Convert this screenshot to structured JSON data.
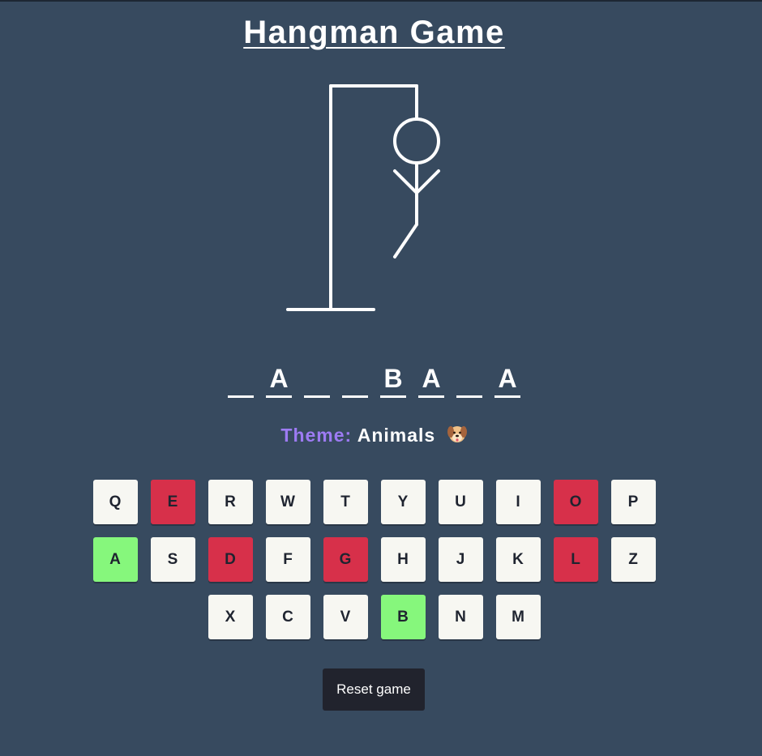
{
  "title": "Hangman Game",
  "word_slots": [
    "",
    "A",
    "",
    "",
    "B",
    "A",
    "",
    "A"
  ],
  "theme": {
    "label": "Theme:",
    "value": "Animals",
    "icon": "dog-face-icon"
  },
  "keyboard": {
    "rows": [
      [
        {
          "letter": "Q",
          "state": "unused"
        },
        {
          "letter": "E",
          "state": "wrong"
        },
        {
          "letter": "R",
          "state": "unused"
        },
        {
          "letter": "W",
          "state": "unused"
        },
        {
          "letter": "T",
          "state": "unused"
        },
        {
          "letter": "Y",
          "state": "unused"
        },
        {
          "letter": "U",
          "state": "unused"
        },
        {
          "letter": "I",
          "state": "unused"
        },
        {
          "letter": "O",
          "state": "wrong"
        },
        {
          "letter": "P",
          "state": "unused"
        }
      ],
      [
        {
          "letter": "A",
          "state": "correct"
        },
        {
          "letter": "S",
          "state": "unused"
        },
        {
          "letter": "D",
          "state": "wrong"
        },
        {
          "letter": "F",
          "state": "unused"
        },
        {
          "letter": "G",
          "state": "wrong"
        },
        {
          "letter": "H",
          "state": "unused"
        },
        {
          "letter": "J",
          "state": "unused"
        },
        {
          "letter": "K",
          "state": "unused"
        },
        {
          "letter": "L",
          "state": "wrong"
        },
        {
          "letter": "Z",
          "state": "unused"
        }
      ],
      [
        {
          "letter": "X",
          "state": "unused"
        },
        {
          "letter": "C",
          "state": "unused"
        },
        {
          "letter": "V",
          "state": "unused"
        },
        {
          "letter": "B",
          "state": "correct"
        },
        {
          "letter": "N",
          "state": "unused"
        },
        {
          "letter": "M",
          "state": "unused"
        }
      ]
    ]
  },
  "hangman": {
    "wrong_guesses": 5,
    "parts_visible": [
      "head",
      "left-arm",
      "right-arm",
      "body",
      "left-leg"
    ]
  },
  "reset_label": "Reset game",
  "colors": {
    "background": "#374a5f",
    "key_default": "#f7f7f2",
    "key_wrong": "#d7304a",
    "key_correct": "#86f77c",
    "theme_label": "#9d7bf3",
    "reset_button": "#21232d"
  }
}
